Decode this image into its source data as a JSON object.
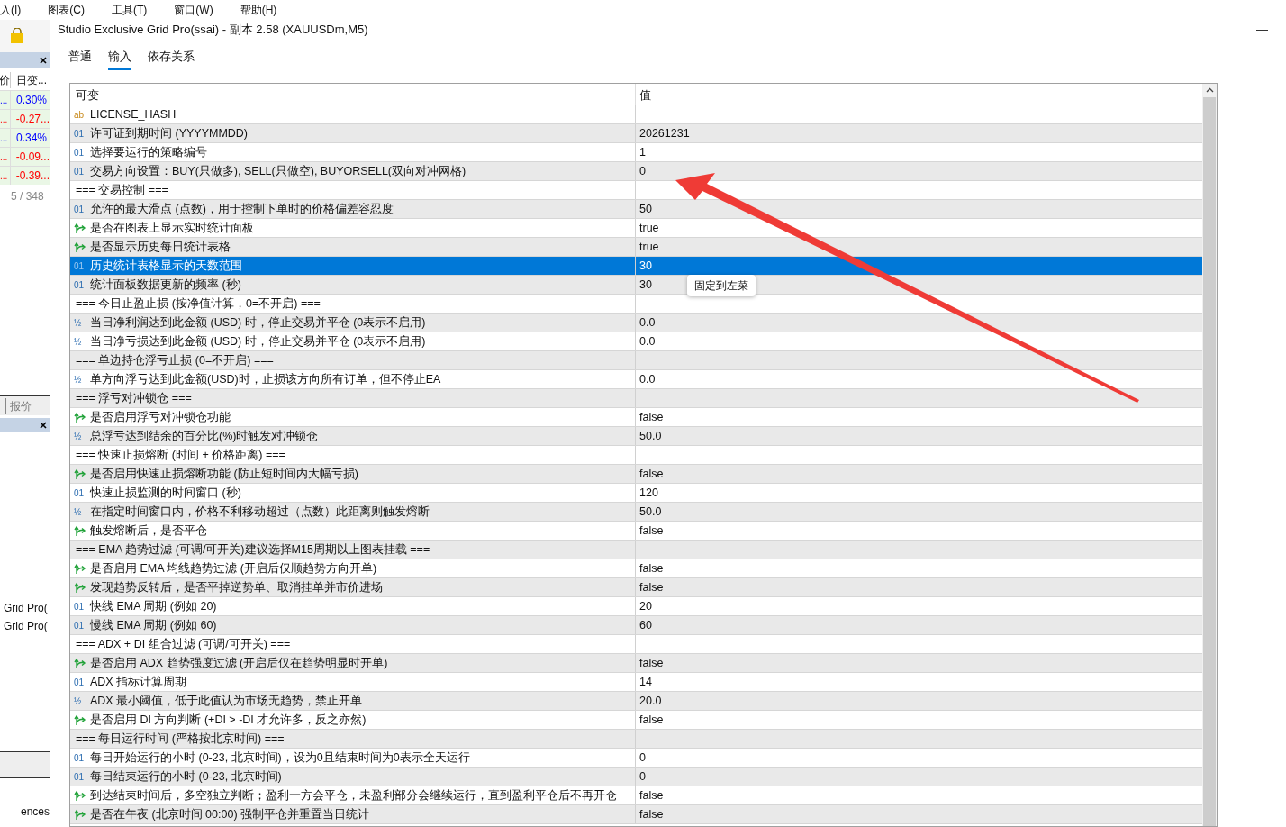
{
  "menu": [
    "入(I)",
    "图表(C)",
    "工具(T)",
    "窗口(W)",
    "帮助(H)"
  ],
  "side_panel": {
    "columns": [
      "价",
      "日变..."
    ],
    "rows": [
      {
        "column_1": "...",
        "change": "0.30%",
        "color": "#0000ff"
      },
      {
        "column_1": "...",
        "change": "-0.27...",
        "color": "#ff0000"
      },
      {
        "column_1": "...",
        "change": "0.34%",
        "color": "#0000ff"
      },
      {
        "column_1": "...",
        "change": "-0.09...",
        "color": "#ff0000"
      },
      {
        "column_1": "...",
        "change": "-0.39...",
        "color": "#ff0000"
      }
    ],
    "count": "5 / 348",
    "tab": "报价",
    "items": [
      "Grid Pro(",
      "Grid Pro("
    ],
    "footer": "ences"
  },
  "window": {
    "title": "Studio Exclusive Grid Pro(ssai) - 副本 2.58 (XAUUSDm,M5)",
    "minimize": "—"
  },
  "tabs": [
    {
      "label": "普通",
      "selected": false
    },
    {
      "label": "输入",
      "selected": true
    },
    {
      "label": "依存关系",
      "selected": false
    }
  ],
  "table": {
    "columns": [
      "可变",
      "值"
    ],
    "rows": [
      {
        "kind": "string",
        "icon": "ab",
        "name": "LICENSE_HASH",
        "value": "",
        "selected": false
      },
      {
        "kind": "int",
        "icon": "01",
        "name": "许可证到期时间 (YYYYMMDD)",
        "value": "20261231",
        "selected": false
      },
      {
        "kind": "int",
        "icon": "01",
        "name": "选择要运行的策略编号",
        "value": "1",
        "selected": false
      },
      {
        "kind": "int",
        "icon": "01",
        "name": "交易方向设置：BUY(只做多), SELL(只做空), BUYORSELL(双向对冲网格)",
        "value": "0",
        "selected": false
      },
      {
        "kind": "section",
        "name": "=== 交易控制 ===",
        "value": "",
        "selected": false
      },
      {
        "kind": "int",
        "icon": "01",
        "name": "允许的最大滑点 (点数)，用于控制下单时的价格偏差容忍度",
        "value": "50",
        "selected": false
      },
      {
        "kind": "bool",
        "name": "是否在图表上显示实时统计面板",
        "value": "true",
        "selected": false
      },
      {
        "kind": "bool",
        "name": "是否显示历史每日统计表格",
        "value": "true",
        "selected": false
      },
      {
        "kind": "int",
        "icon": "01",
        "name": "历史统计表格显示的天数范围",
        "value": "30",
        "selected": true
      },
      {
        "kind": "int",
        "icon": "01",
        "name": "统计面板数据更新的频率 (秒)",
        "value": "30",
        "selected": false
      },
      {
        "kind": "section",
        "name": "=== 今日止盈止损 (按净值计算，0=不开启) ===",
        "value": "",
        "selected": false
      },
      {
        "kind": "double",
        "icon": "½",
        "name": "当日净利润达到此金额 (USD) 时，停止交易并平仓 (0表示不启用)",
        "value": "0.0",
        "selected": false
      },
      {
        "kind": "double",
        "icon": "½",
        "name": "当日净亏损达到此金额 (USD) 时，停止交易并平仓 (0表示不启用)",
        "value": "0.0",
        "selected": false
      },
      {
        "kind": "section",
        "name": "=== 单边持仓浮亏止损 (0=不开启) ===",
        "value": "",
        "selected": false
      },
      {
        "kind": "double",
        "icon": "½",
        "name": "单方向浮亏达到此金额(USD)时，止损该方向所有订单，但不停止EA",
        "value": "0.0",
        "selected": false
      },
      {
        "kind": "section",
        "name": "=== 浮亏对冲锁仓 ===",
        "value": "",
        "selected": false
      },
      {
        "kind": "bool",
        "name": "是否启用浮亏对冲锁仓功能",
        "value": "false",
        "selected": false
      },
      {
        "kind": "double",
        "icon": "½",
        "name": "总浮亏达到结余的百分比(%)时触发对冲锁仓",
        "value": "50.0",
        "selected": false
      },
      {
        "kind": "section",
        "name": "=== 快速止损熔断 (时间 + 价格距离) ===",
        "value": "",
        "selected": false
      },
      {
        "kind": "bool",
        "name": "是否启用快速止损熔断功能 (防止短时间内大幅亏损)",
        "value": "false",
        "selected": false
      },
      {
        "kind": "int",
        "icon": "01",
        "name": "快速止损监测的时间窗口 (秒)",
        "value": "120",
        "selected": false
      },
      {
        "kind": "double",
        "icon": "½",
        "name": "在指定时间窗口内，价格不利移动超过（点数）此距离则触发熔断",
        "value": "50.0",
        "selected": false
      },
      {
        "kind": "bool",
        "name": "触发熔断后，是否平仓",
        "value": "false",
        "selected": false
      },
      {
        "kind": "section",
        "name": "===  EMA 趋势过滤 (可调/可开关)建议选择M15周期以上图表挂载 ===",
        "value": "",
        "selected": false
      },
      {
        "kind": "bool",
        "name": "是否启用 EMA 均线趋势过滤 (开启后仅顺趋势方向开单)",
        "value": "false",
        "selected": false
      },
      {
        "kind": "bool",
        "name": "发现趋势反转后，是否平掉逆势单、取消挂单并市价进场",
        "value": "false",
        "selected": false
      },
      {
        "kind": "int",
        "icon": "01",
        "name": "快线 EMA 周期 (例如 20)",
        "value": "20",
        "selected": false
      },
      {
        "kind": "int",
        "icon": "01",
        "name": "慢线 EMA 周期 (例如 60)",
        "value": "60",
        "selected": false
      },
      {
        "kind": "section",
        "name": "=== ADX + DI 组合过滤 (可调/可开关) ===",
        "value": "",
        "selected": false
      },
      {
        "kind": "bool",
        "name": "是否启用 ADX 趋势强度过滤 (开启后仅在趋势明显时开单)",
        "value": "false",
        "selected": false
      },
      {
        "kind": "int",
        "icon": "01",
        "name": "ADX 指标计算周期",
        "value": "14",
        "selected": false
      },
      {
        "kind": "double",
        "icon": "½",
        "name": "ADX 最小阈值，低于此值认为市场无趋势，禁止开单",
        "value": "20.0",
        "selected": false
      },
      {
        "kind": "bool",
        "name": "是否启用 DI 方向判断 (+DI > -DI 才允许多，反之亦然)",
        "value": "false",
        "selected": false
      },
      {
        "kind": "section",
        "name": "=== 每日运行时间 (严格按北京时间) ===",
        "value": "",
        "selected": false
      },
      {
        "kind": "int",
        "icon": "01",
        "name": "每日开始运行的小时 (0-23, 北京时间)，设为0且结束时间为0表示全天运行",
        "value": "0",
        "selected": false
      },
      {
        "kind": "int",
        "icon": "01",
        "name": "每日结束运行的小时 (0-23, 北京时间)",
        "value": "0",
        "selected": false
      },
      {
        "kind": "bool",
        "name": "到达结束时间后，多空独立判断；盈利一方会平仓，未盈利部分会继续运行，直到盈利平仓后不再开仓",
        "value": "false",
        "selected": false
      },
      {
        "kind": "bool",
        "name": "是否在午夜 (北京时间 00:00) 强制平仓并重置当日统计",
        "value": "false",
        "selected": false
      }
    ]
  },
  "tooltip": "固定到左菜"
}
